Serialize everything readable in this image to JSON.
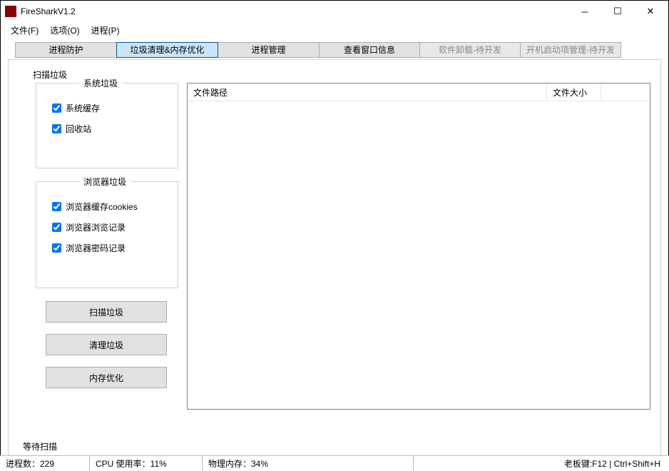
{
  "window": {
    "title": "FireSharkV1.2"
  },
  "menu": {
    "file": "文件(F)",
    "options": "选项(O)",
    "process": "进程(P)"
  },
  "tabs": {
    "t1": "进程防护",
    "t2": "垃圾清理&内存优化",
    "t3": "进程管理",
    "t4": "查看窗口信息",
    "t5": "软件卸载-待开发",
    "t6": "开机启动项管理-待开发"
  },
  "panel": {
    "title": "扫描垃圾",
    "group_system": {
      "title": "系统垃圾",
      "chk_cache": "系统缓存",
      "chk_recycle": "回收站"
    },
    "group_browser": {
      "title": "浏览器垃圾",
      "chk_cookies": "浏览器缓存cookies",
      "chk_history": "浏览器浏览记录",
      "chk_passwords": "浏览器密码记录"
    },
    "btn_scan": "扫描垃圾",
    "btn_clean": "清理垃圾",
    "btn_mem": "内存优化",
    "status": "等待扫描"
  },
  "listview": {
    "col_path": "文件路径",
    "col_size": "文件大小"
  },
  "statusbar": {
    "procs": "进程数：229",
    "cpu": "CPU 使用率：11%",
    "mem": "物理内存：34%",
    "hotkey": "老板键:F12 | Ctrl+Shift+H"
  }
}
